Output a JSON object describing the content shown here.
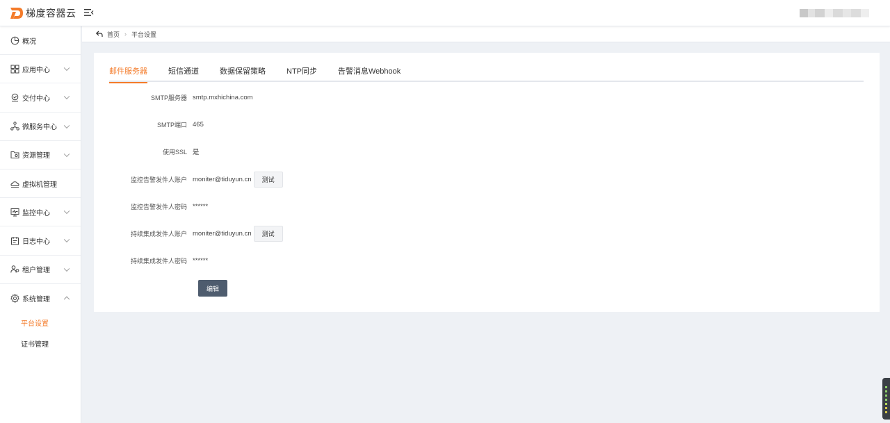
{
  "header": {
    "logo_text": "梯度容器云",
    "brand_color": "#f47b2a"
  },
  "sidebar": {
    "items": [
      {
        "label": "概况",
        "icon": "pie-chart-icon",
        "has_arrow": false
      },
      {
        "label": "应用中心",
        "icon": "grid-icon",
        "has_arrow": true
      },
      {
        "label": "交付中心",
        "icon": "delivery-icon",
        "has_arrow": true
      },
      {
        "label": "微服务中心",
        "icon": "network-icon",
        "has_arrow": true
      },
      {
        "label": "资源管理",
        "icon": "folder-icon",
        "has_arrow": true
      },
      {
        "label": "虚拟机管理",
        "icon": "cloud-icon",
        "has_arrow": false
      },
      {
        "label": "监控中心",
        "icon": "monitor-icon",
        "has_arrow": true
      },
      {
        "label": "日志中心",
        "icon": "calendar-icon",
        "has_arrow": true
      },
      {
        "label": "租户管理",
        "icon": "users-icon",
        "has_arrow": true
      },
      {
        "label": "系统管理",
        "icon": "gear-icon",
        "has_arrow": true,
        "expanded": true
      }
    ],
    "sub_items": [
      {
        "label": "平台设置",
        "active": true
      },
      {
        "label": "证书管理",
        "active": false
      }
    ]
  },
  "breadcrumb": {
    "home": "首页",
    "current": "平台设置"
  },
  "tabs": [
    {
      "label": "邮件服务器",
      "active": true
    },
    {
      "label": "短信通道",
      "active": false
    },
    {
      "label": "数据保留策略",
      "active": false
    },
    {
      "label": "NTP同步",
      "active": false
    },
    {
      "label": "告警消息Webhook",
      "active": false
    }
  ],
  "form": {
    "smtp_server": {
      "label": "SMTP服务器",
      "value": "smtp.mxhichina.com"
    },
    "smtp_port": {
      "label": "SMTP端口",
      "value": "465"
    },
    "use_ssl": {
      "label": "使用SSL",
      "value": "是"
    },
    "monitor_account": {
      "label": "监控告警发件人账户",
      "value": "moniter@tiduyun.cn"
    },
    "monitor_password": {
      "label": "监控告警发件人密码",
      "value": "******"
    },
    "ci_account": {
      "label": "持续集成发件人账户",
      "value": "moniter@tiduyun.cn"
    },
    "ci_password": {
      "label": "持续集成发件人密码",
      "value": "******"
    },
    "test_label": "测试",
    "edit_label": "编辑"
  }
}
